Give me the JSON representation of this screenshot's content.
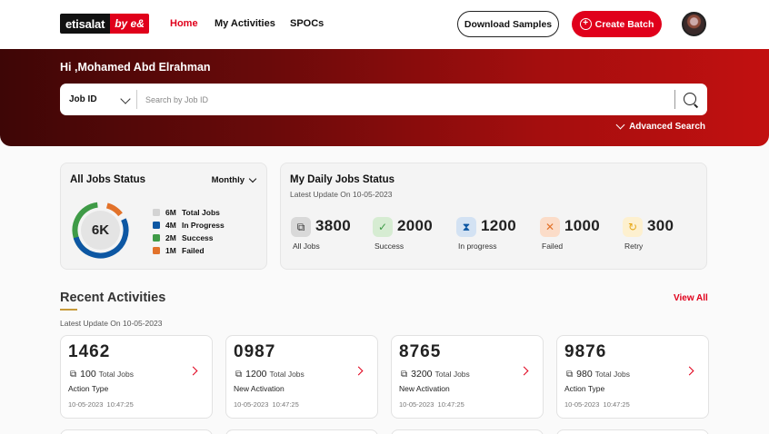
{
  "brand": {
    "name": "etisalat",
    "mark": "by e&",
    "accent": "#e0001b"
  },
  "nav": {
    "items": [
      {
        "label": "Home",
        "active": true
      },
      {
        "label": "My Activities",
        "active": false
      },
      {
        "label": "SPOCs",
        "active": false
      }
    ]
  },
  "actions": {
    "download_label": "Download Samples",
    "create_label": "Create Batch"
  },
  "hero": {
    "greeting": "Hi ,Mohamed Abd Elrahman",
    "search": {
      "field": "Job ID",
      "placeholder": "Search by Job ID"
    },
    "advanced_label": "Advanced Search"
  },
  "all_jobs": {
    "title": "All Jobs Status",
    "period": "Monthly",
    "center_label": "6K",
    "legend": [
      {
        "value": "6M",
        "label": "Total Jobs",
        "color": "#d3d3d3"
      },
      {
        "value": "4M",
        "label": "In Progress",
        "color": "#0d57a3"
      },
      {
        "value": "2M",
        "label": "Success",
        "color": "#3f9b47"
      },
      {
        "value": "1M",
        "label": "Failed",
        "color": "#e2722a"
      }
    ]
  },
  "daily": {
    "title": "My Daily Jobs Status",
    "subtitle": "Latest Update On 10-05-2023",
    "stats": [
      {
        "value": "3800",
        "label": "All Jobs",
        "icon": "jobs-icon",
        "bg": "#d9d9d9",
        "fg": "#333"
      },
      {
        "value": "2000",
        "label": "Success",
        "icon": "success-icon",
        "bg": "#d6ecd2",
        "fg": "#3f9b47"
      },
      {
        "value": "1200",
        "label": "In progress",
        "icon": "hourglass-icon",
        "bg": "#d3e2f3",
        "fg": "#0d57a3"
      },
      {
        "value": "1000",
        "label": "Failed",
        "icon": "failed-icon",
        "bg": "#fbdcc8",
        "fg": "#e2722a"
      },
      {
        "value": "300",
        "label": "Retry",
        "icon": "retry-icon",
        "bg": "#fdf0cf",
        "fg": "#e6a817"
      }
    ]
  },
  "recent": {
    "title": "Recent Activities",
    "view_all": "View All",
    "subtitle": "Latest Update On 10-05-2023",
    "cards": [
      {
        "id": "1462",
        "count": "100",
        "count_label": "Total Jobs",
        "type": "Action Type",
        "date": "10-05-2023",
        "time": "10:47:25"
      },
      {
        "id": "0987",
        "count": "1200",
        "count_label": "Total Jobs",
        "type": "New Activation",
        "date": "10-05-2023",
        "time": "10:47:25"
      },
      {
        "id": "8765",
        "count": "3200",
        "count_label": "Total Jobs",
        "type": "New Activation",
        "date": "10-05-2023",
        "time": "10:47:25"
      },
      {
        "id": "9876",
        "count": "980",
        "count_label": "Total Jobs",
        "type": "Action Type",
        "date": "10-05-2023",
        "time": "10:47:25"
      }
    ]
  }
}
